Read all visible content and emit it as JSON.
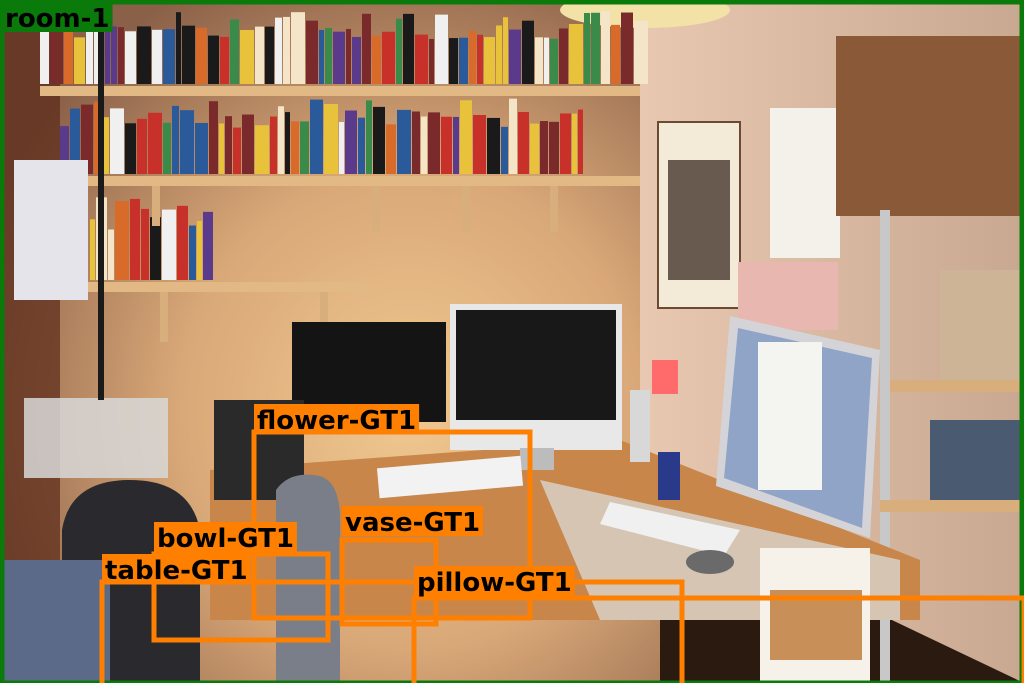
{
  "colors": {
    "room": "#0a7a0a",
    "object": "#ff8000"
  },
  "annotations": [
    {
      "label": "room-1",
      "kind": "room"
    },
    {
      "label": "flower-GT1",
      "kind": "object"
    },
    {
      "label": "bowl-GT1",
      "kind": "object"
    },
    {
      "label": "vase-GT1",
      "kind": "object"
    },
    {
      "label": "table-GT1",
      "kind": "object"
    },
    {
      "label": "pillow-GT1",
      "kind": "object"
    }
  ]
}
